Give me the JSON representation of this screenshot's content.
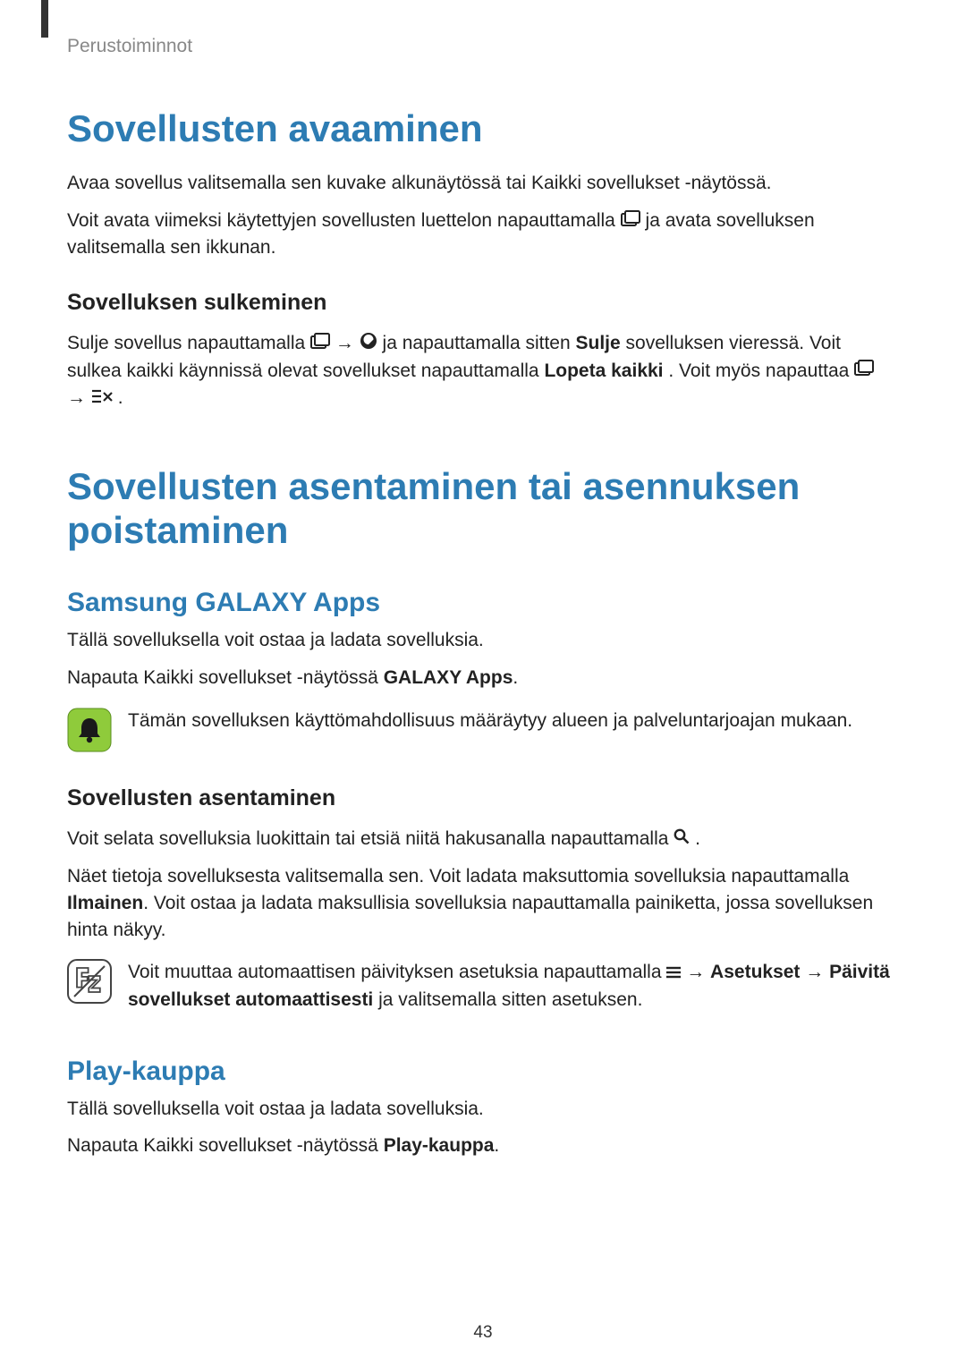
{
  "header": {
    "breadcrumb": "Perustoiminnot"
  },
  "s1": {
    "title": "Sovellusten avaaminen",
    "p1": "Avaa sovellus valitsemalla sen kuvake alkunäytössä tai Kaikki sovellukset -näytössä.",
    "p2a": "Voit avata viimeksi käytettyjen sovellusten luettelon napauttamalla ",
    "p2b": " ja avata sovelluksen valitsemalla sen ikkunan.",
    "h3": "Sovelluksen sulkeminen",
    "p3a": "Sulje sovellus napauttamalla ",
    "p3b": " → ",
    "p3c": " ja napauttamalla sitten ",
    "p3d": "Sulje",
    "p3e": " sovelluksen vieressä. Voit sulkea kaikki käynnissä olevat sovellukset napauttamalla ",
    "p3f": "Lopeta kaikki",
    "p3g": ". Voit myös napauttaa ",
    "p3h": " → ",
    "p3i": "."
  },
  "s2": {
    "title": "Sovellusten asentaminen tai asennuksen poistaminen",
    "h2a": "Samsung GALAXY Apps",
    "p1": "Tällä sovelluksella voit ostaa ja ladata sovelluksia.",
    "p2a": "Napauta Kaikki sovellukset -näytössä ",
    "p2b": "GALAXY Apps",
    "p2c": ".",
    "note1": "Tämän sovelluksen käyttömahdollisuus määräytyy alueen ja palveluntarjoajan mukaan.",
    "h3a": "Sovellusten asentaminen",
    "p3a": "Voit selata sovelluksia luokittain tai etsiä niitä hakusanalla napauttamalla ",
    "p3b": ".",
    "p4a": "Näet tietoja sovelluksesta valitsemalla sen. Voit ladata maksuttomia sovelluksia napauttamalla ",
    "p4b": "Ilmainen",
    "p4c": ". Voit ostaa ja ladata maksullisia sovelluksia napauttamalla painiketta, jossa sovelluksen hinta näkyy.",
    "note2a": "Voit muuttaa automaattisen päivityksen asetuksia napauttamalla ",
    "note2b": " → ",
    "note2c": "Asetukset",
    "note2d": " → ",
    "note2e": "Päivitä sovellukset automaattisesti",
    "note2f": " ja valitsemalla sitten asetuksen.",
    "h2b": "Play-kauppa",
    "p5": "Tällä sovelluksella voit ostaa ja ladata sovelluksia.",
    "p6a": "Napauta Kaikki sovellukset -näytössä ",
    "p6b": "Play-kauppa",
    "p6c": "."
  },
  "pagenum": "43"
}
